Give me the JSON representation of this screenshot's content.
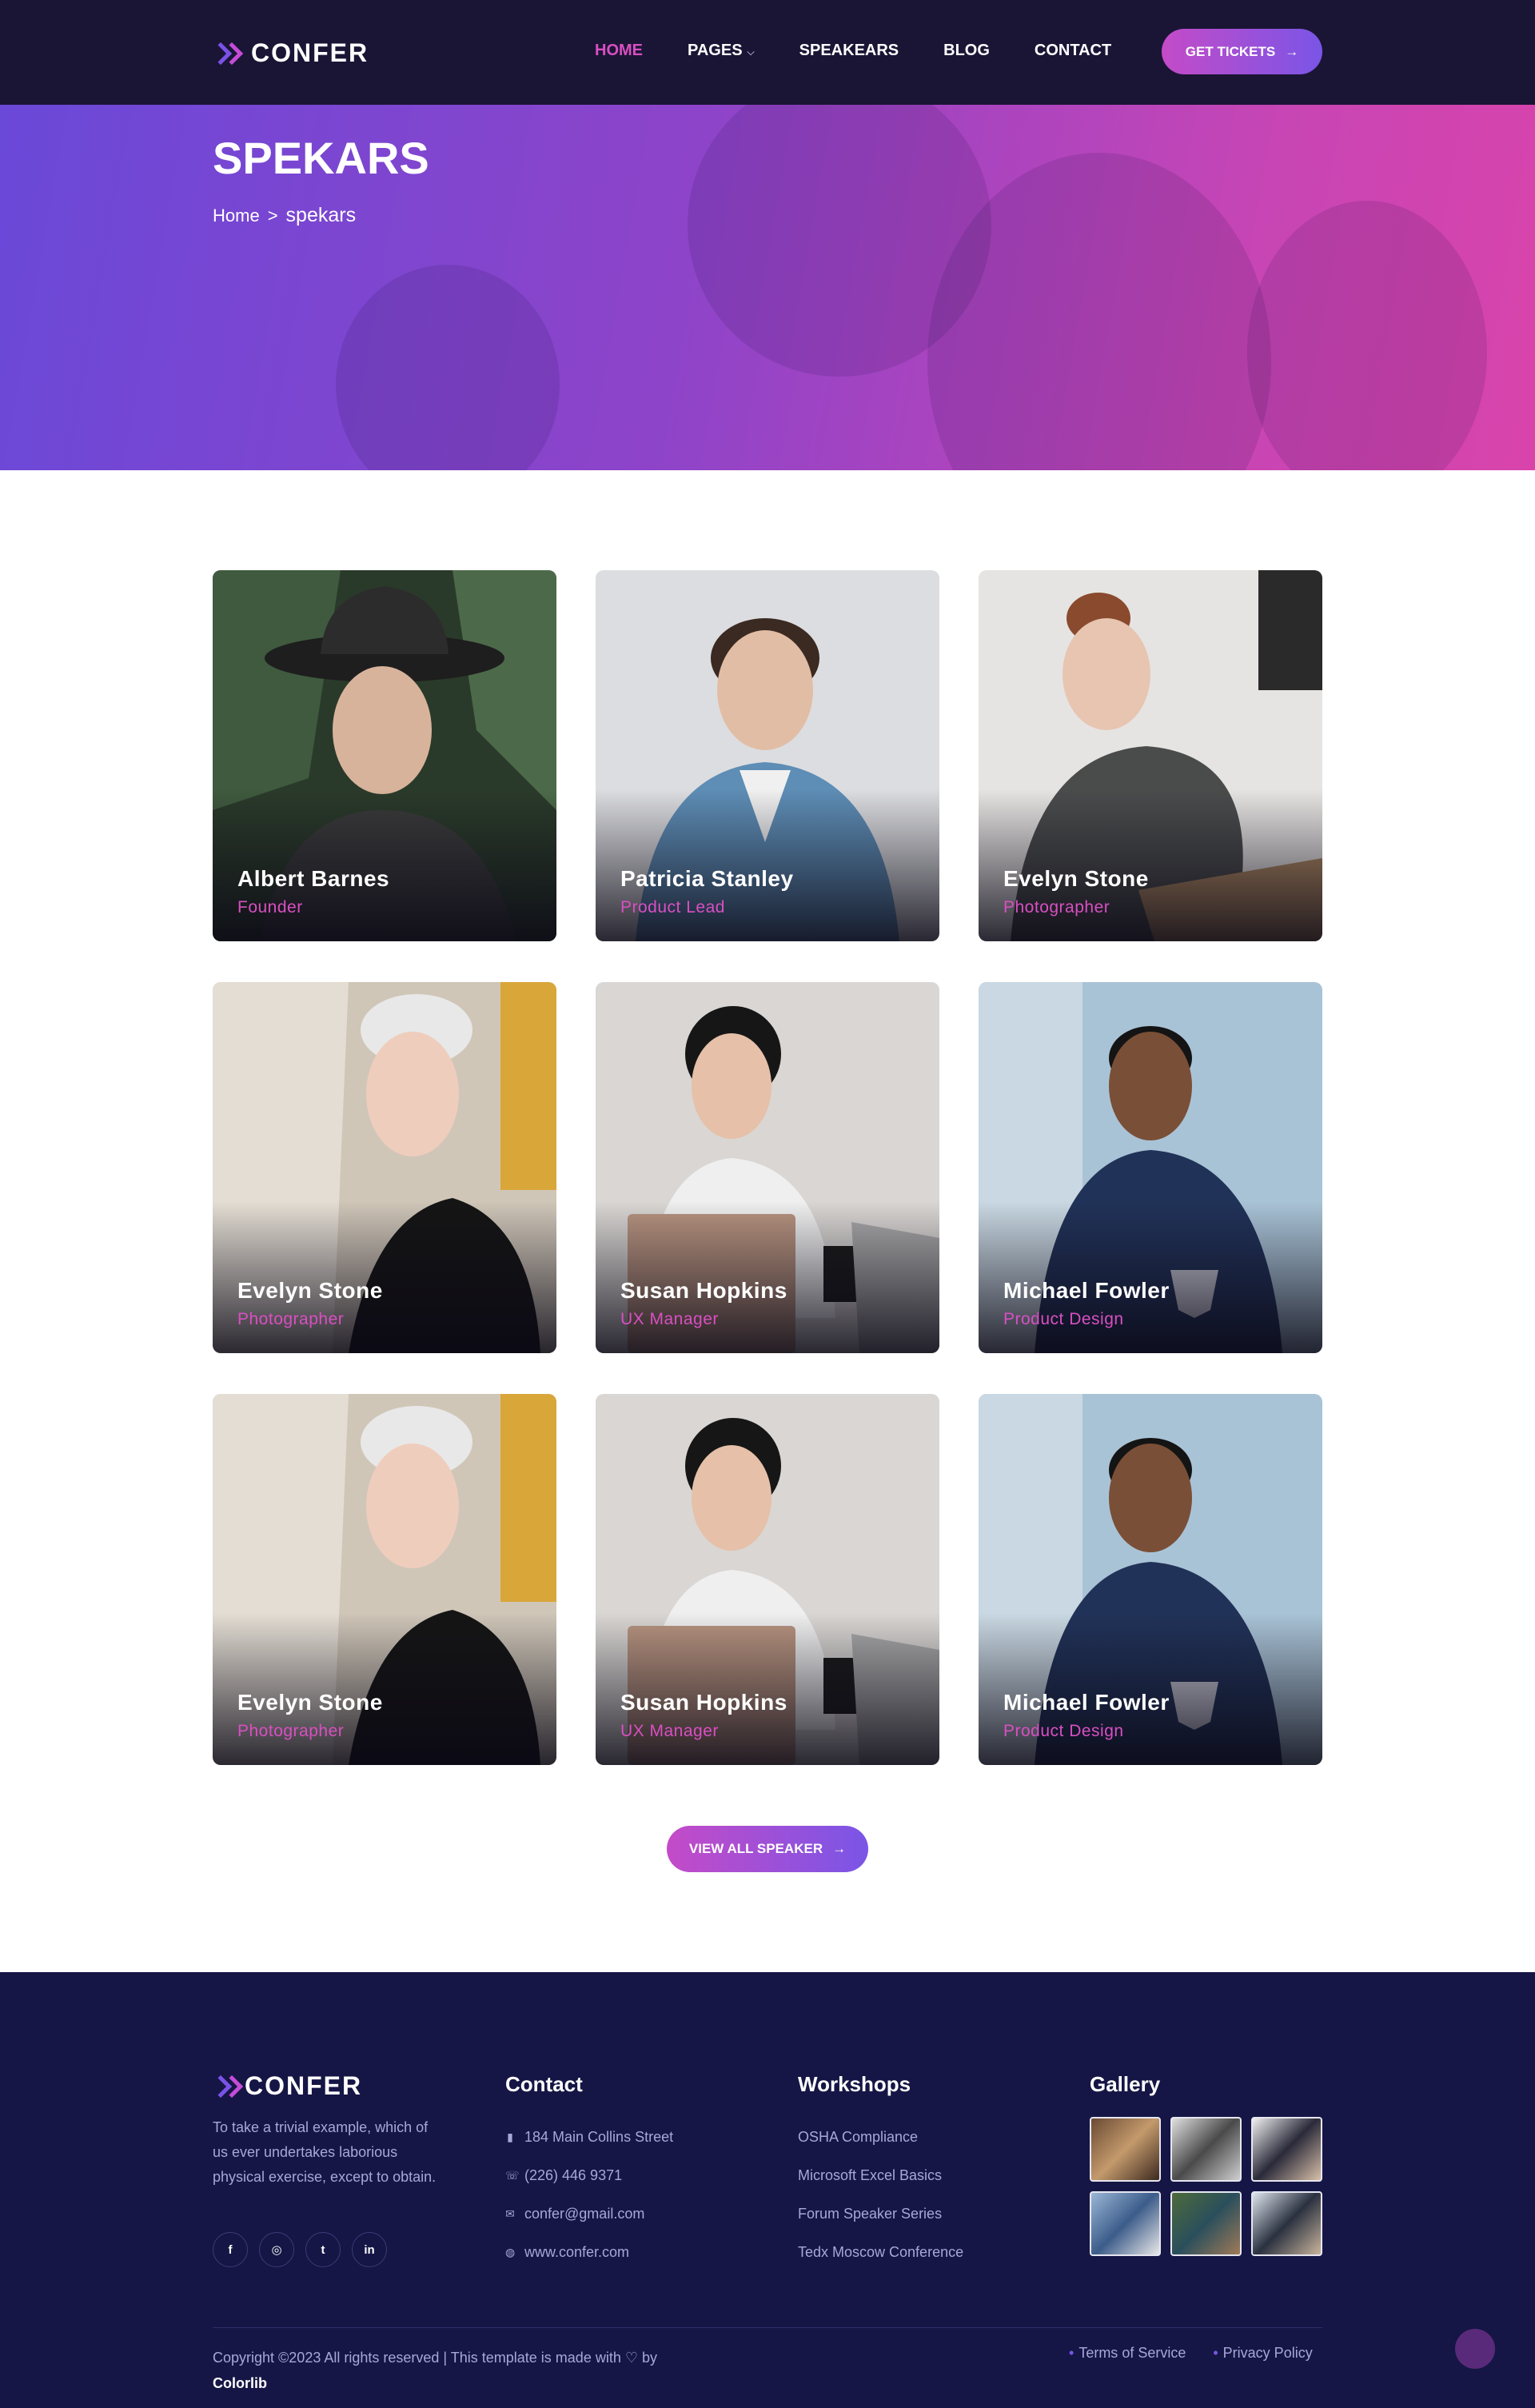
{
  "header": {
    "logo_text": "CONFER",
    "nav": [
      {
        "label": "HOME"
      },
      {
        "label": "PAGES"
      },
      {
        "label": "SPEAKEARS"
      },
      {
        "label": "BLOG"
      },
      {
        "label": "CONTACT"
      }
    ],
    "tickets_label": "GET TICKETS",
    "tickets_icon": "arrow-right-icon"
  },
  "hero": {
    "title": "SPEKARS",
    "breadcrumb_home": "Home",
    "breadcrumb_sep": ">",
    "breadcrumb_current": "spekars"
  },
  "speakers": [
    {
      "name": "Albert Barnes",
      "role": "Founder"
    },
    {
      "name": "Patricia Stanley",
      "role": "Product Lead"
    },
    {
      "name": "Evelyn Stone",
      "role": "Photographer"
    },
    {
      "name": "Evelyn Stone",
      "role": "Photographer"
    },
    {
      "name": "Susan Hopkins",
      "role": "UX Manager"
    },
    {
      "name": "Michael Fowler",
      "role": "Product Design"
    },
    {
      "name": "Evelyn Stone",
      "role": "Photographer"
    },
    {
      "name": "Susan Hopkins",
      "role": "UX Manager"
    },
    {
      "name": "Michael Fowler",
      "role": "Product Design"
    }
  ],
  "view_all_label": "VIEW ALL SPEAKER",
  "footer": {
    "logo_text": "CONFER",
    "about": "To take a trivial example, which of us ever undertakes laborious physical exercise, except to obtain.",
    "socials": [
      {
        "icon": "facebook-icon",
        "glyph": "f"
      },
      {
        "icon": "instagram-icon",
        "glyph": "◎"
      },
      {
        "icon": "twitter-icon",
        "glyph": "t"
      },
      {
        "icon": "linkedin-icon",
        "glyph": "in"
      }
    ],
    "contact_title": "Contact",
    "contact": [
      {
        "icon": "map-icon",
        "glyph": "▮",
        "text": "184 Main Collins Street"
      },
      {
        "icon": "phone-icon",
        "glyph": "☏",
        "text": "(226) 446 9371"
      },
      {
        "icon": "mail-icon",
        "glyph": "✉",
        "text": "confer@gmail.com"
      },
      {
        "icon": "globe-icon",
        "glyph": "◍",
        "text": "www.confer.com"
      }
    ],
    "workshops_title": "Workshops",
    "workshops": [
      "OSHA Compliance",
      "Microsoft Excel Basics",
      "Forum Speaker Series",
      "Tedx Moscow Conference"
    ],
    "gallery_title": "Gallery",
    "copyright": "Copyright ©2023 All rights reserved | This template is made with ♡ by",
    "copyright_brand": "Colorlib",
    "legal": [
      "Terms of Service",
      "Privacy Policy"
    ]
  },
  "colors": {
    "accent_pink": "#d94fc2",
    "accent_purple": "#7a55e6",
    "header_bg": "#1a1535",
    "footer_bg": "#151645"
  }
}
